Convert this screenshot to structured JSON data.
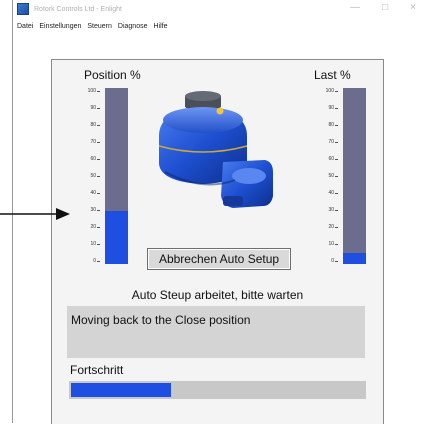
{
  "window": {
    "title": "Rotork Controls Ltd - Enlight",
    "controls": {
      "minimize": "—",
      "maximize": "□",
      "close": "×"
    }
  },
  "menu": [
    "Datei",
    "Einstellungen",
    "Steuern",
    "Diagnose",
    "Hilfe"
  ],
  "position_gauge": {
    "label": "Position %",
    "value_percent": 30,
    "ticks": [
      "100",
      "90",
      "80",
      "70",
      "60",
      "50",
      "40",
      "30",
      "20",
      "10",
      "0"
    ]
  },
  "load_gauge": {
    "label": "Last %",
    "value_percent": 6,
    "ticks": [
      "100",
      "90",
      "80",
      "70",
      "60",
      "50",
      "40",
      "30",
      "20",
      "10",
      "0"
    ]
  },
  "actions": {
    "cancel_label": "Abbrechen Auto Setup"
  },
  "status": {
    "text": "Auto Steup arbeitet, bitte warten"
  },
  "message": {
    "text": "Moving back to the Close position"
  },
  "progress": {
    "label": "Fortschritt",
    "value_percent": 34
  },
  "colors": {
    "bar_fill": "#1e4fe0",
    "bar_track": "#6c6c8e",
    "panel_bg": "#f4f4f4",
    "actuator_blue": "#1d4fd0"
  },
  "icons": {
    "app": "app-icon",
    "actuator": "actuator-image",
    "pointer": "arrow-pointer-icon"
  }
}
